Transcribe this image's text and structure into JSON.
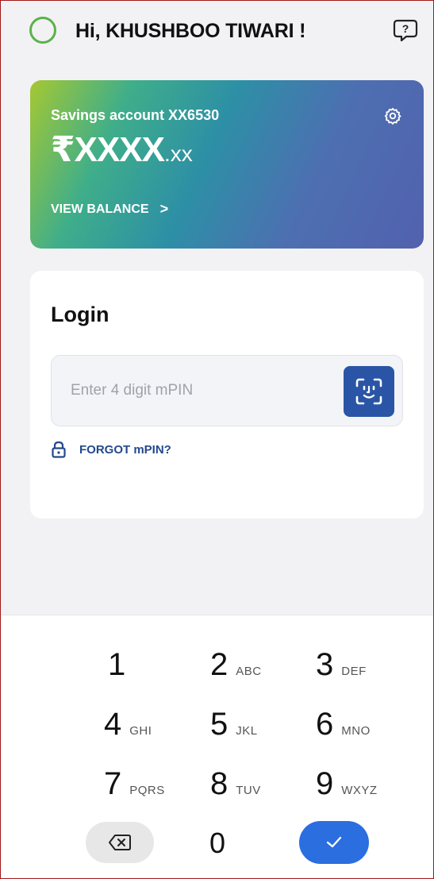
{
  "header": {
    "greeting": "Hi, KHUSHBOO TIWARI !",
    "avatar_icon": "avatar-ring-icon",
    "help_icon": "help-chat-icon"
  },
  "account": {
    "title": "Savings account XX6530",
    "balance_main": "₹XXXX",
    "balance_decimal": ".xx",
    "view_balance_label": "VIEW BALANCE",
    "view_balance_chevron": ">",
    "settings_icon": "gear-icon"
  },
  "login": {
    "title": "Login",
    "pin_placeholder": "Enter 4 digit mPIN",
    "face_icon": "face-id-icon",
    "forgot_label": "FORGOT mPIN?",
    "lock_icon": "lock-icon"
  },
  "keypad": {
    "keys": [
      {
        "num": "1",
        "letters": ""
      },
      {
        "num": "2",
        "letters": "ABC"
      },
      {
        "num": "3",
        "letters": "DEF"
      },
      {
        "num": "4",
        "letters": "GHI"
      },
      {
        "num": "5",
        "letters": "JKL"
      },
      {
        "num": "6",
        "letters": "MNO"
      },
      {
        "num": "7",
        "letters": "PQRS"
      },
      {
        "num": "8",
        "letters": "TUV"
      },
      {
        "num": "9",
        "letters": "WXYZ"
      },
      {
        "num": "0",
        "letters": ""
      }
    ],
    "backspace_icon": "backspace-icon",
    "confirm_icon": "check-icon"
  },
  "colors": {
    "accent_green": "#5ab24a",
    "brand_blue": "#2a55a6",
    "confirm_blue": "#2a6ee0",
    "link_blue": "#23498c"
  }
}
